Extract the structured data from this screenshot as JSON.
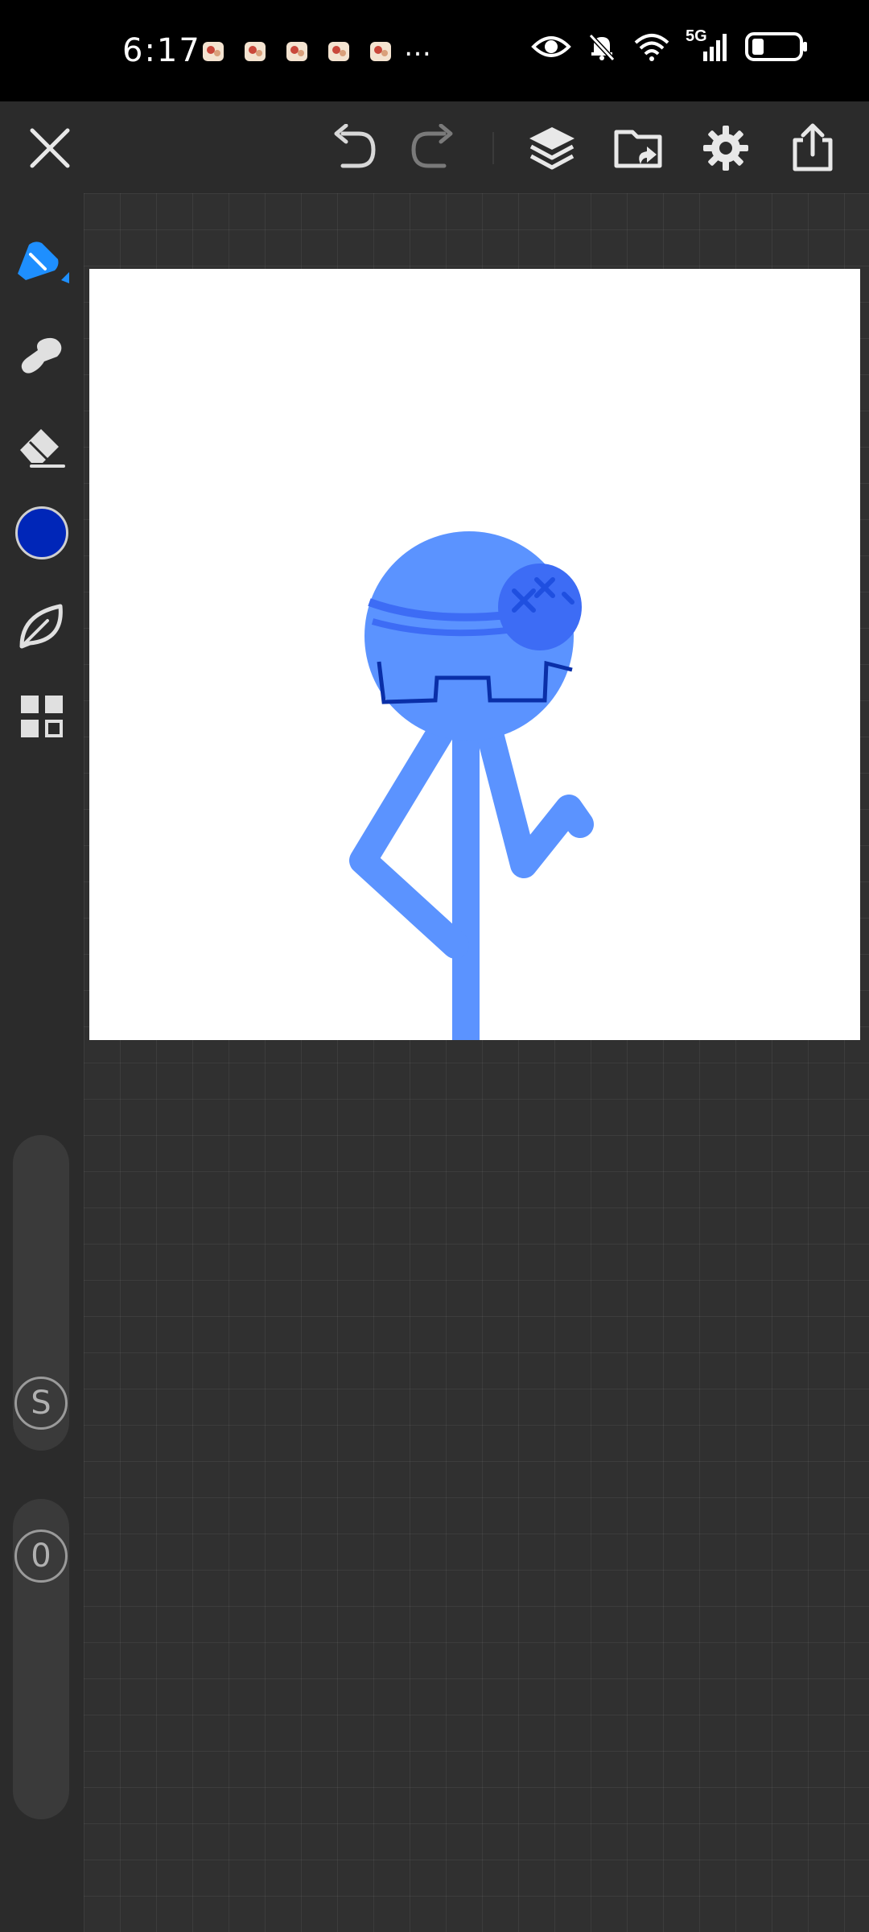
{
  "status_bar": {
    "time": "6:17",
    "more_indicator": "…",
    "network_label": "5G"
  },
  "toolbar": {
    "close": "close-icon",
    "undo": "undo-icon",
    "redo": "redo-icon",
    "layers": "layers-icon",
    "import": "import-folder-icon",
    "settings": "gear-icon",
    "export": "share-icon"
  },
  "tools": {
    "items": [
      "brush-tool",
      "smudge-tool",
      "eraser-tool",
      "color-swatch",
      "leaf-brush",
      "gallery-grid"
    ],
    "current_color": "#0026b8"
  },
  "sliders": {
    "size_label": "S",
    "opacity_label": "0"
  },
  "canvas": {
    "background": "#ffffff",
    "figure_color": "#5b93ff",
    "bandage_color": "#3d6cf5",
    "mouth_color": "#0a2fa8"
  }
}
